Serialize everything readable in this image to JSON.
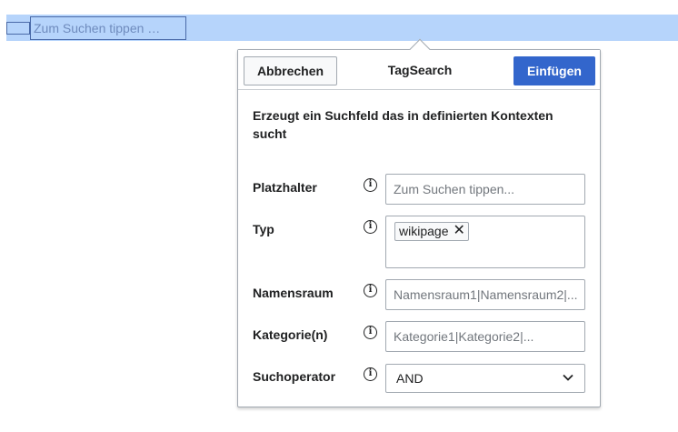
{
  "editor": {
    "search_placeholder": "Zum Suchen tippen …"
  },
  "dialog": {
    "title": "TagSearch",
    "cancel_label": "Abbrechen",
    "insert_label": "Einfügen",
    "description": "Erzeugt ein Suchfeld das in definierten Kontexten sucht",
    "info_glyph": "i",
    "fields": {
      "placeholder": {
        "label": "Platzhalter",
        "placeholder": "Zum Suchen tippen..."
      },
      "type": {
        "label": "Typ",
        "tag": "wikipage",
        "remove_glyph": "✕"
      },
      "namespace": {
        "label": "Namensraum",
        "placeholder": "Namensraum1|Namensraum2|..."
      },
      "category": {
        "label": "Kategorie(n)",
        "placeholder": "Kategorie1|Kategorie2|..."
      },
      "operator": {
        "label": "Suchoperator",
        "value": "AND",
        "options": [
          "AND"
        ]
      }
    }
  },
  "colors": {
    "selection": "#b6d4fb",
    "primary": "#3366cc",
    "border": "#a2a9b1",
    "text": "#202122"
  },
  "icons": [
    "info-icon",
    "close-icon",
    "chevron-down-icon"
  ]
}
